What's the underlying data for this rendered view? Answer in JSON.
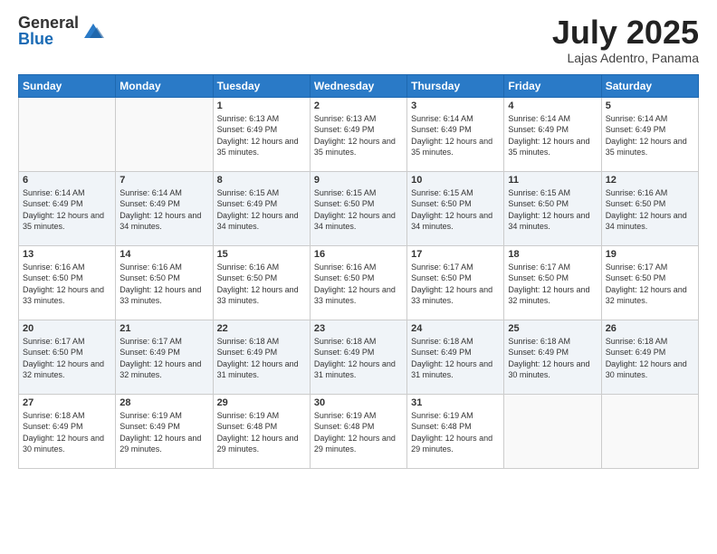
{
  "header": {
    "logo_general": "General",
    "logo_blue": "Blue",
    "month_title": "July 2025",
    "location": "Lajas Adentro, Panama"
  },
  "days_of_week": [
    "Sunday",
    "Monday",
    "Tuesday",
    "Wednesday",
    "Thursday",
    "Friday",
    "Saturday"
  ],
  "weeks": [
    [
      {
        "day": "",
        "info": ""
      },
      {
        "day": "",
        "info": ""
      },
      {
        "day": "1",
        "info": "Sunrise: 6:13 AM\nSunset: 6:49 PM\nDaylight: 12 hours and 35 minutes."
      },
      {
        "day": "2",
        "info": "Sunrise: 6:13 AM\nSunset: 6:49 PM\nDaylight: 12 hours and 35 minutes."
      },
      {
        "day": "3",
        "info": "Sunrise: 6:14 AM\nSunset: 6:49 PM\nDaylight: 12 hours and 35 minutes."
      },
      {
        "day": "4",
        "info": "Sunrise: 6:14 AM\nSunset: 6:49 PM\nDaylight: 12 hours and 35 minutes."
      },
      {
        "day": "5",
        "info": "Sunrise: 6:14 AM\nSunset: 6:49 PM\nDaylight: 12 hours and 35 minutes."
      }
    ],
    [
      {
        "day": "6",
        "info": "Sunrise: 6:14 AM\nSunset: 6:49 PM\nDaylight: 12 hours and 35 minutes."
      },
      {
        "day": "7",
        "info": "Sunrise: 6:14 AM\nSunset: 6:49 PM\nDaylight: 12 hours and 34 minutes."
      },
      {
        "day": "8",
        "info": "Sunrise: 6:15 AM\nSunset: 6:49 PM\nDaylight: 12 hours and 34 minutes."
      },
      {
        "day": "9",
        "info": "Sunrise: 6:15 AM\nSunset: 6:50 PM\nDaylight: 12 hours and 34 minutes."
      },
      {
        "day": "10",
        "info": "Sunrise: 6:15 AM\nSunset: 6:50 PM\nDaylight: 12 hours and 34 minutes."
      },
      {
        "day": "11",
        "info": "Sunrise: 6:15 AM\nSunset: 6:50 PM\nDaylight: 12 hours and 34 minutes."
      },
      {
        "day": "12",
        "info": "Sunrise: 6:16 AM\nSunset: 6:50 PM\nDaylight: 12 hours and 34 minutes."
      }
    ],
    [
      {
        "day": "13",
        "info": "Sunrise: 6:16 AM\nSunset: 6:50 PM\nDaylight: 12 hours and 33 minutes."
      },
      {
        "day": "14",
        "info": "Sunrise: 6:16 AM\nSunset: 6:50 PM\nDaylight: 12 hours and 33 minutes."
      },
      {
        "day": "15",
        "info": "Sunrise: 6:16 AM\nSunset: 6:50 PM\nDaylight: 12 hours and 33 minutes."
      },
      {
        "day": "16",
        "info": "Sunrise: 6:16 AM\nSunset: 6:50 PM\nDaylight: 12 hours and 33 minutes."
      },
      {
        "day": "17",
        "info": "Sunrise: 6:17 AM\nSunset: 6:50 PM\nDaylight: 12 hours and 33 minutes."
      },
      {
        "day": "18",
        "info": "Sunrise: 6:17 AM\nSunset: 6:50 PM\nDaylight: 12 hours and 32 minutes."
      },
      {
        "day": "19",
        "info": "Sunrise: 6:17 AM\nSunset: 6:50 PM\nDaylight: 12 hours and 32 minutes."
      }
    ],
    [
      {
        "day": "20",
        "info": "Sunrise: 6:17 AM\nSunset: 6:50 PM\nDaylight: 12 hours and 32 minutes."
      },
      {
        "day": "21",
        "info": "Sunrise: 6:17 AM\nSunset: 6:49 PM\nDaylight: 12 hours and 32 minutes."
      },
      {
        "day": "22",
        "info": "Sunrise: 6:18 AM\nSunset: 6:49 PM\nDaylight: 12 hours and 31 minutes."
      },
      {
        "day": "23",
        "info": "Sunrise: 6:18 AM\nSunset: 6:49 PM\nDaylight: 12 hours and 31 minutes."
      },
      {
        "day": "24",
        "info": "Sunrise: 6:18 AM\nSunset: 6:49 PM\nDaylight: 12 hours and 31 minutes."
      },
      {
        "day": "25",
        "info": "Sunrise: 6:18 AM\nSunset: 6:49 PM\nDaylight: 12 hours and 30 minutes."
      },
      {
        "day": "26",
        "info": "Sunrise: 6:18 AM\nSunset: 6:49 PM\nDaylight: 12 hours and 30 minutes."
      }
    ],
    [
      {
        "day": "27",
        "info": "Sunrise: 6:18 AM\nSunset: 6:49 PM\nDaylight: 12 hours and 30 minutes."
      },
      {
        "day": "28",
        "info": "Sunrise: 6:19 AM\nSunset: 6:49 PM\nDaylight: 12 hours and 29 minutes."
      },
      {
        "day": "29",
        "info": "Sunrise: 6:19 AM\nSunset: 6:48 PM\nDaylight: 12 hours and 29 minutes."
      },
      {
        "day": "30",
        "info": "Sunrise: 6:19 AM\nSunset: 6:48 PM\nDaylight: 12 hours and 29 minutes."
      },
      {
        "day": "31",
        "info": "Sunrise: 6:19 AM\nSunset: 6:48 PM\nDaylight: 12 hours and 29 minutes."
      },
      {
        "day": "",
        "info": ""
      },
      {
        "day": "",
        "info": ""
      }
    ]
  ]
}
